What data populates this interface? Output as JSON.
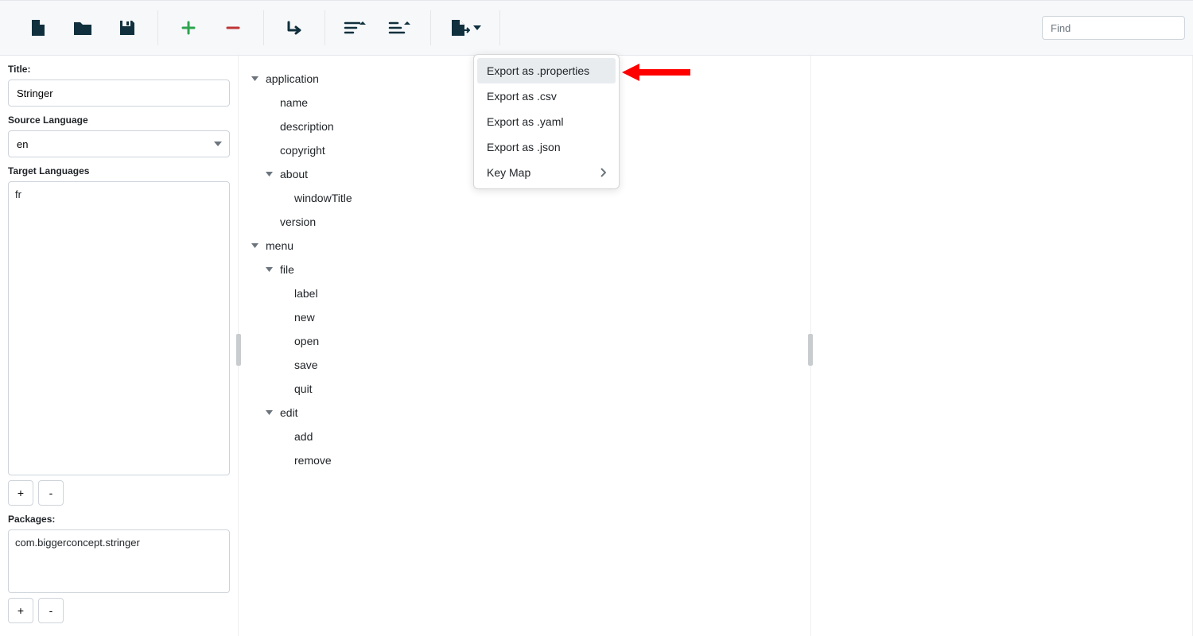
{
  "sidebar": {
    "title_label": "Title:",
    "title_value": "Stringer",
    "source_lang_label": "Source Language",
    "source_lang_value": "en",
    "target_langs_label": "Target Languages",
    "target_langs": [
      "fr"
    ],
    "add_btn": "+",
    "remove_btn": "-",
    "packages_label": "Packages:",
    "packages": [
      "com.biggerconcept.stringer"
    ]
  },
  "tree": [
    {
      "label": "application",
      "level": 0,
      "expandable": true
    },
    {
      "label": "name",
      "level": 1,
      "expandable": false
    },
    {
      "label": "description",
      "level": 1,
      "expandable": false
    },
    {
      "label": "copyright",
      "level": 1,
      "expandable": false
    },
    {
      "label": "about",
      "level": 1,
      "expandable": true
    },
    {
      "label": "windowTitle",
      "level": 2,
      "expandable": false
    },
    {
      "label": "version",
      "level": 1,
      "expandable": false
    },
    {
      "label": "menu",
      "level": 0,
      "expandable": true
    },
    {
      "label": "file",
      "level": 1,
      "expandable": true
    },
    {
      "label": "label",
      "level": 2,
      "expandable": false
    },
    {
      "label": "new",
      "level": 2,
      "expandable": false
    },
    {
      "label": "open",
      "level": 2,
      "expandable": false
    },
    {
      "label": "save",
      "level": 2,
      "expandable": false
    },
    {
      "label": "quit",
      "level": 2,
      "expandable": false
    },
    {
      "label": "edit",
      "level": 1,
      "expandable": true
    },
    {
      "label": "add",
      "level": 2,
      "expandable": false
    },
    {
      "label": "remove",
      "level": 2,
      "expandable": false
    }
  ],
  "export_menu": {
    "items": [
      {
        "label": "Export as .properties",
        "highlight": true,
        "submenu": false
      },
      {
        "label": "Export as .csv",
        "highlight": false,
        "submenu": false
      },
      {
        "label": "Export as .yaml",
        "highlight": false,
        "submenu": false
      },
      {
        "label": "Export as .json",
        "highlight": false,
        "submenu": false
      },
      {
        "label": "Key Map",
        "highlight": false,
        "submenu": true
      }
    ]
  },
  "search": {
    "placeholder": "Find"
  }
}
